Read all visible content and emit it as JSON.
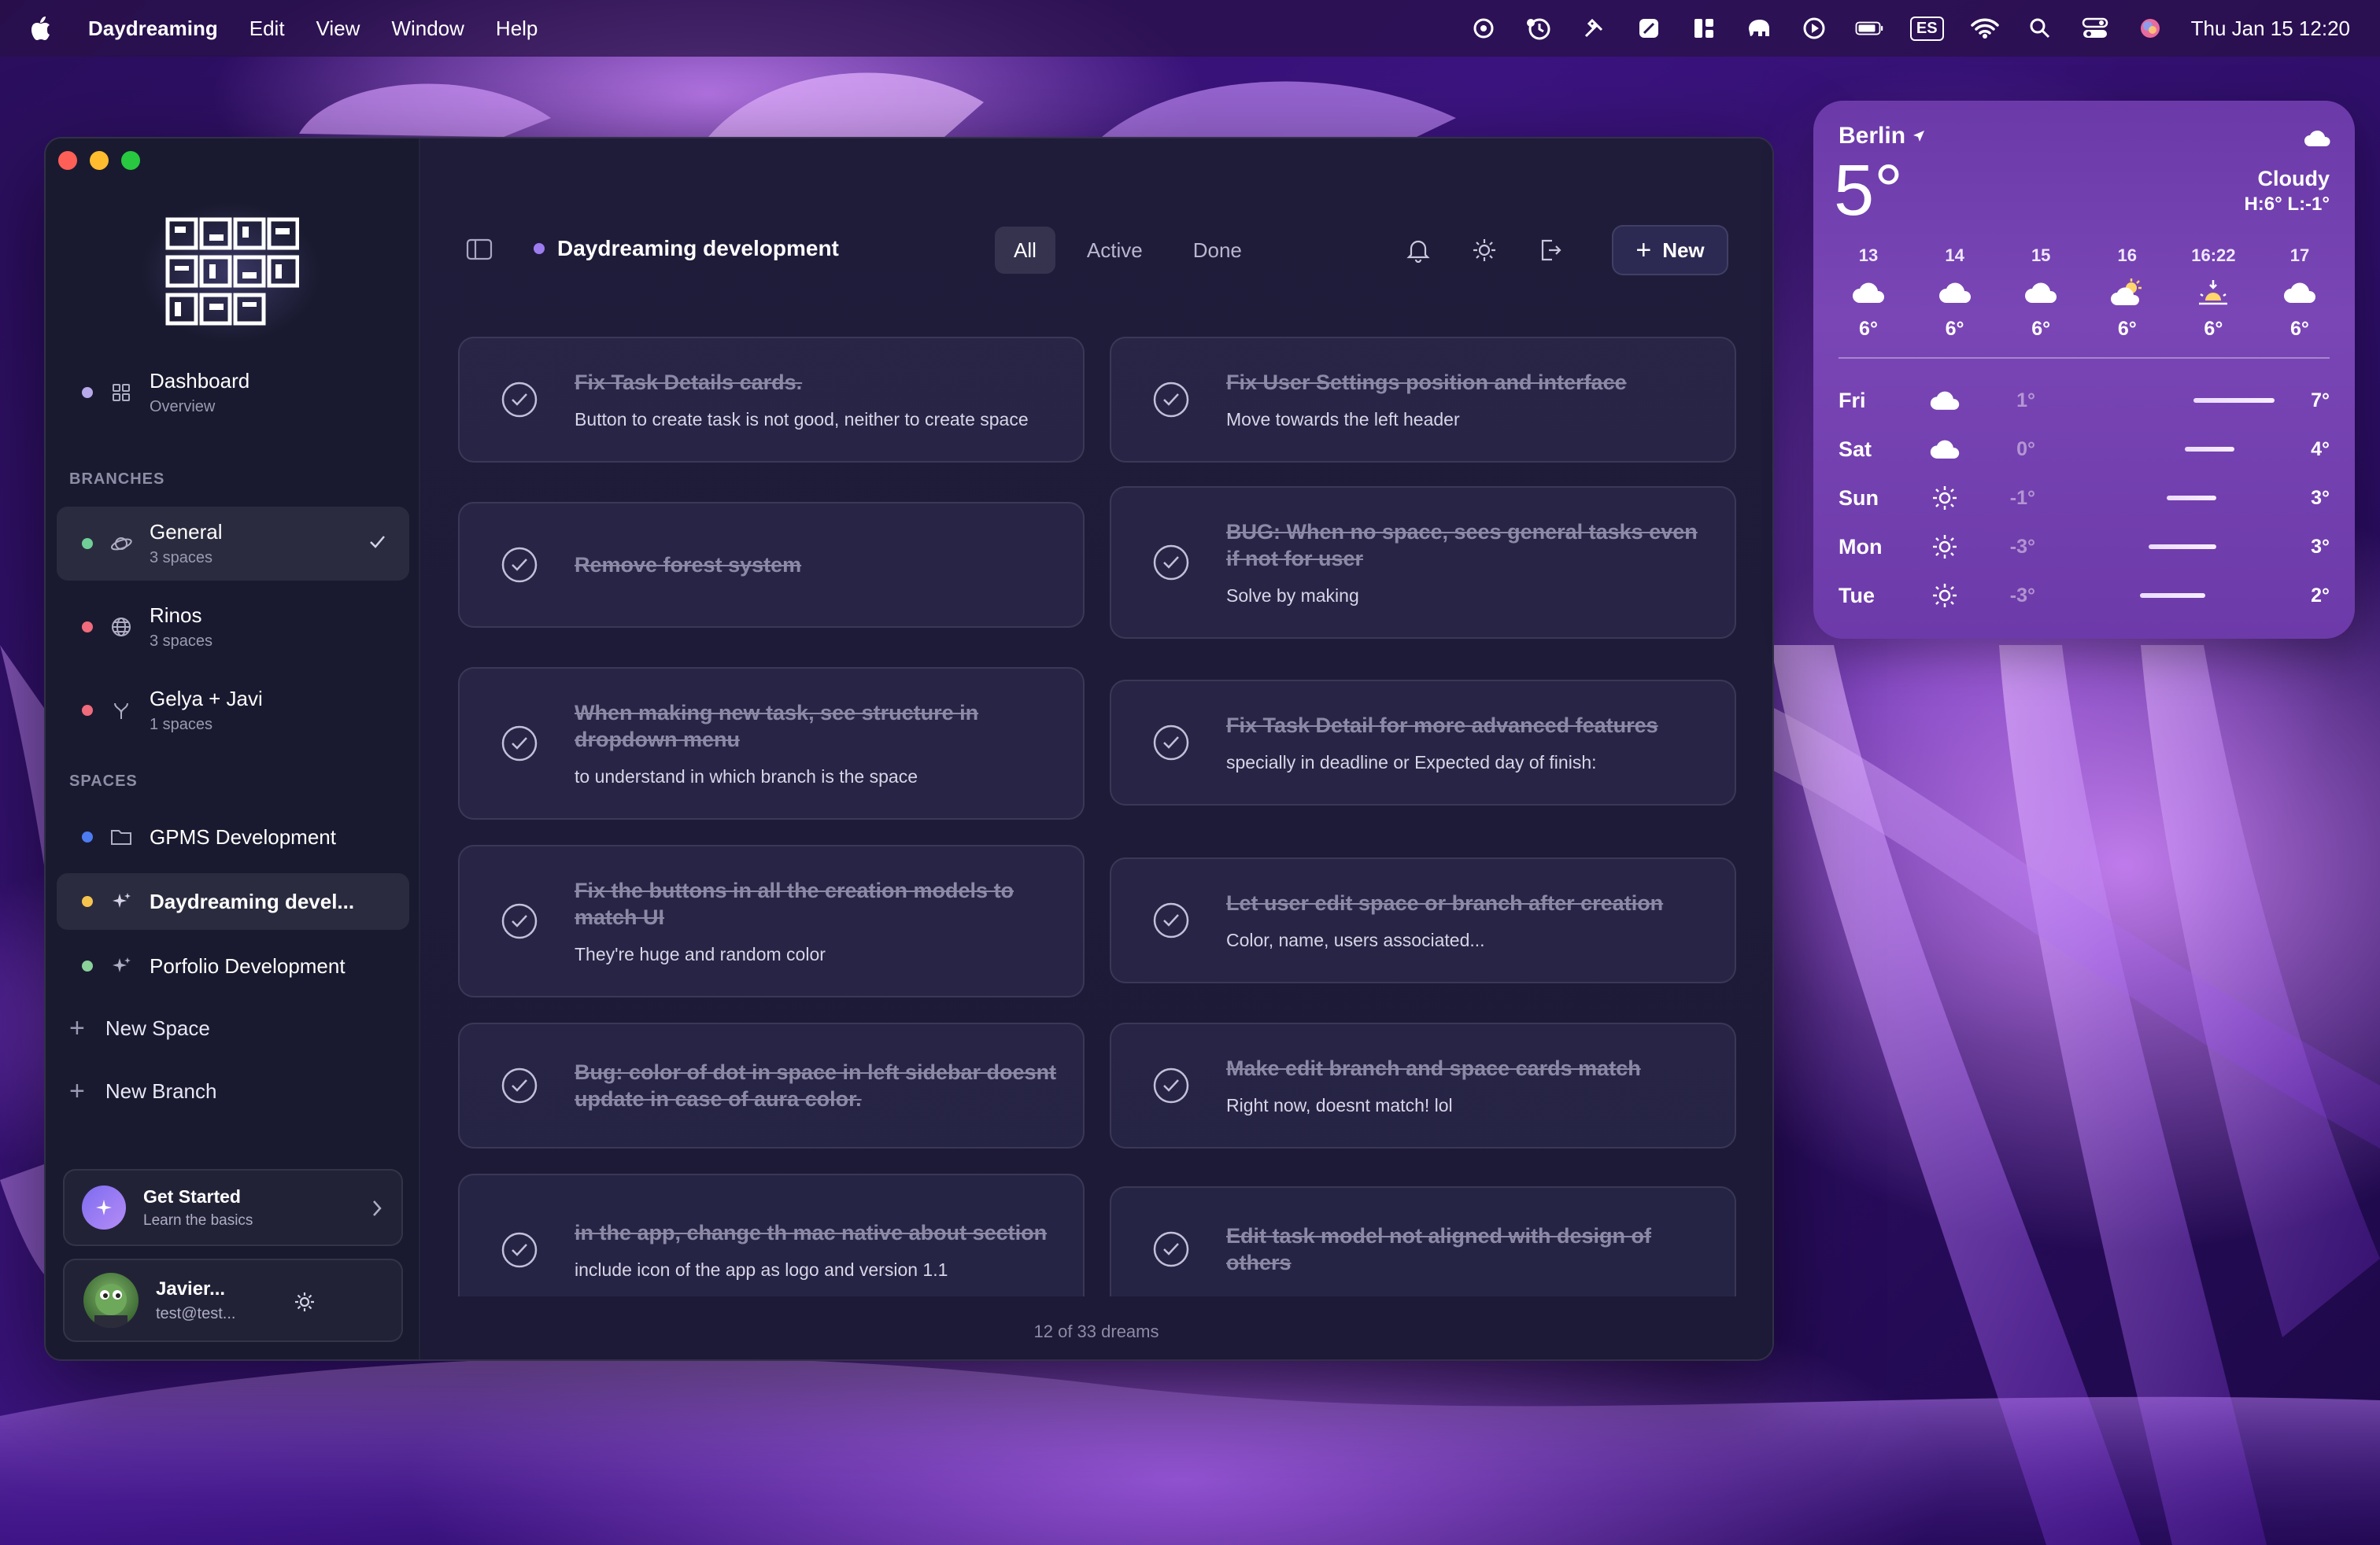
{
  "menubar": {
    "app_name": "Daydreaming",
    "menus": [
      "Edit",
      "View",
      "Window",
      "Help"
    ],
    "input_source": "ES",
    "clock": "Thu Jan 15  12:20"
  },
  "sidebar": {
    "dashboard": {
      "title": "Dashboard",
      "subtitle": "Overview"
    },
    "branches_label": "BRANCHES",
    "branches": [
      {
        "title": "General",
        "subtitle": "3 spaces",
        "dot_color": "#6fcf97",
        "selected": true
      },
      {
        "title": "Rinos",
        "subtitle": "3 spaces",
        "dot_color": "#f06b7b"
      },
      {
        "title": "Gelya + Javi",
        "subtitle": "1 spaces",
        "dot_color": "#f06b7b"
      }
    ],
    "spaces_label": "SPACES",
    "spaces": [
      {
        "title": "GPMS Development",
        "dot_color": "#4c7cf0"
      },
      {
        "title": "Daydreaming devel...",
        "dot_color": "#f5c44e",
        "selected": true
      },
      {
        "title": "Porfolio Development",
        "dot_color": "#8ad19a"
      }
    ],
    "new_space": "New Space",
    "new_branch": "New Branch",
    "get_started": {
      "title": "Get Started",
      "subtitle": "Learn the basics"
    },
    "user": {
      "name": "Javier...",
      "email": "test@test..."
    }
  },
  "toolbar": {
    "space_title": "Daydreaming development",
    "filters": [
      "All",
      "Active",
      "Done"
    ],
    "active_filter": "All",
    "new_label": "New"
  },
  "cards": [
    {
      "title": "Fix Task Details cards.",
      "desc": "Button to create task is not good, neither to create space"
    },
    {
      "title": "Fix User Settings position and interface",
      "desc": "Move towards the left header"
    },
    {
      "title": "Remove forest system",
      "desc": ""
    },
    {
      "title": "BUG: When no space, sees general tasks even if not for user",
      "desc": "Solve by making"
    },
    {
      "title": "When making new task, see structure in dropdown menu",
      "desc": "to understand in which branch is the space"
    },
    {
      "title": "Fix Task Detail for more advanced features",
      "desc": "specially in deadline or Expected day of finish:"
    },
    {
      "title": "Fix the buttons in all the creation models to match UI",
      "desc": "They're huge and random color"
    },
    {
      "title": "Let user edit space or branch after creation",
      "desc": "Color, name, users associated..."
    },
    {
      "title": "Bug: color of dot in space in left sidebar doesnt update in case of aura color.",
      "desc": ""
    },
    {
      "title": "Make edit branch and space cards match",
      "desc": "Right now, doesnt match! lol"
    },
    {
      "title": "in the app, change th mac native about section",
      "desc": "include icon of the app as logo and version 1.1"
    },
    {
      "title": "Edit task model not aligned with design of others",
      "desc": ""
    }
  ],
  "footer": {
    "count_text": "12 of 33 dreams"
  },
  "weather": {
    "city": "Berlin",
    "temp": "5°",
    "condition": "Cloudy",
    "high_low": "H:6° L:-1°",
    "hourly": [
      {
        "label": "13",
        "icon": "cloud-icon",
        "temp": "6°"
      },
      {
        "label": "14",
        "icon": "cloud-icon",
        "temp": "6°"
      },
      {
        "label": "15",
        "icon": "cloud-icon",
        "temp": "6°"
      },
      {
        "label": "16",
        "icon": "partly-sunny-icon",
        "temp": "6°"
      },
      {
        "label": "16:22",
        "icon": "sunset-icon",
        "temp": "6°"
      },
      {
        "label": "17",
        "icon": "cloud-icon",
        "temp": "6°"
      }
    ],
    "daily": [
      {
        "day": "Fri",
        "icon": "cloud-icon",
        "low": "1°",
        "high": "7°",
        "bar": [
          0.62,
          0.98
        ]
      },
      {
        "day": "Sat",
        "icon": "cloud-icon",
        "low": "0°",
        "high": "4°",
        "bar": [
          0.58,
          0.8
        ]
      },
      {
        "day": "Sun",
        "icon": "sun-icon",
        "low": "-1°",
        "high": "3°",
        "bar": [
          0.5,
          0.72
        ]
      },
      {
        "day": "Mon",
        "icon": "sun-icon",
        "low": "-3°",
        "high": "3°",
        "bar": [
          0.42,
          0.72
        ]
      },
      {
        "day": "Tue",
        "icon": "sun-icon",
        "low": "-3°",
        "high": "2°",
        "bar": [
          0.38,
          0.67
        ]
      }
    ]
  }
}
